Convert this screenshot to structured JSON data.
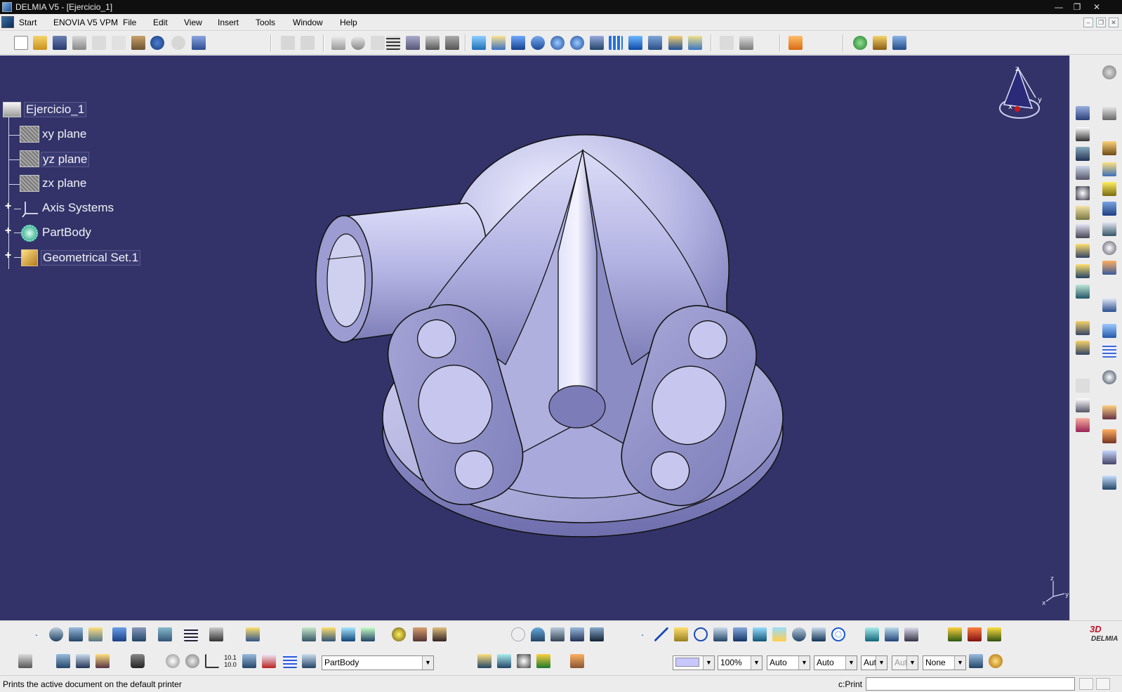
{
  "window": {
    "title": "DELMIA V5 - [Ejercicio_1]",
    "minimize_glyph": "—",
    "restore_glyph": "❐",
    "close_glyph": "✕"
  },
  "menubar": {
    "items": [
      "Start",
      "ENOVIA V5 VPM",
      "File",
      "Edit",
      "View",
      "Insert",
      "Tools",
      "Window",
      "Help"
    ],
    "mdi_minimize": "–",
    "mdi_restore": "❐",
    "mdi_close": "✕"
  },
  "tree": {
    "root": "Ejercicio_1",
    "nodes": [
      {
        "label": "xy plane",
        "icon": "plane-icon"
      },
      {
        "label": "yz plane",
        "icon": "plane-icon"
      },
      {
        "label": "zx plane",
        "icon": "plane-icon"
      },
      {
        "label": "Axis Systems",
        "icon": "axis-system-icon"
      },
      {
        "label": "PartBody",
        "icon": "part-body-gear-icon"
      },
      {
        "label": "Geometrical Set.1",
        "icon": "geometrical-set-icon"
      }
    ]
  },
  "compass": {
    "x": "x",
    "y": "y",
    "z": "z"
  },
  "bottom": {
    "body_select": "PartBody",
    "color_value": "",
    "transparency": "100%",
    "linetype": "Auto",
    "thickness": "Auto",
    "point_symbol": "Aut",
    "layer_disabled": "Aut",
    "layer": "None"
  },
  "status": {
    "message": "Prints the active document on the default printer",
    "command_label": "c:Print",
    "command_value": ""
  },
  "brand": {
    "logo": "DELMIA"
  },
  "colors": {
    "viewport_bg": "#33336a",
    "part_fill": "#b8b8e6",
    "tree_text": "#f2f2f6"
  }
}
